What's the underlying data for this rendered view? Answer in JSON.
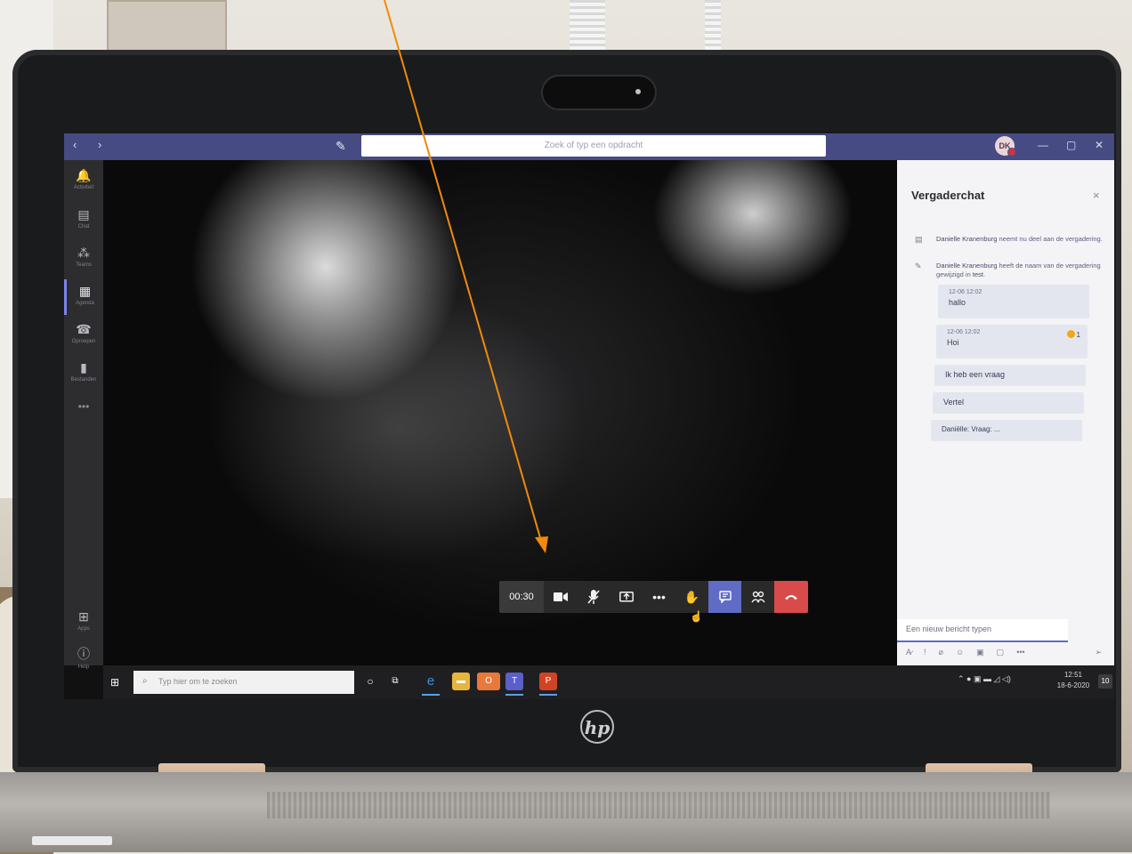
{
  "titlebar": {
    "search_placeholder": "Zoek of typ een opdracht",
    "avatar_initials": "DK",
    "nav_glyphs": "‹ ›",
    "minimize": "—",
    "maximize": "▢",
    "close": "✕"
  },
  "rail": {
    "items": [
      {
        "icon": "bell-icon",
        "glyph": "🔔",
        "label": "Activiteit"
      },
      {
        "icon": "chat-icon",
        "glyph": "▤",
        "label": "Chat"
      },
      {
        "icon": "teams-icon",
        "glyph": "⁂",
        "label": "Teams"
      },
      {
        "icon": "calendar-icon",
        "glyph": "▦",
        "label": "Agenda"
      },
      {
        "icon": "phone-icon",
        "glyph": "☎",
        "label": "Oproepen"
      },
      {
        "icon": "files-icon",
        "glyph": "▮",
        "label": "Bestanden"
      }
    ],
    "more": "•••",
    "apps_label": "Apps",
    "help_label": "Help"
  },
  "controls": {
    "timer": "00:30"
  },
  "chat": {
    "title": "Vergaderchat",
    "close_glyph": "×",
    "system_1": {
      "name": "Danielle Kranenburg",
      "text": " neemt nu deel aan de vergadering."
    },
    "system_2": {
      "name": "Danielle Kranenburg",
      "text_a": " heeft de naam van de vergadering gewijzigd in ",
      "meeting_name": "test",
      "text_b": "."
    },
    "messages": [
      {
        "time": "12-06 12:02",
        "text": "hallo"
      },
      {
        "time": "12-06 12:02",
        "text": "Hoi",
        "reaction_count": "1"
      },
      {
        "time": "",
        "text": "Ik heb een vraag"
      },
      {
        "time": "",
        "text": "Vertel"
      },
      {
        "time": "",
        "text": "Daniëlle: Vraag: ..."
      }
    ],
    "compose_placeholder": "Een nieuw bericht typen"
  },
  "taskbar": {
    "search_placeholder": "Typ hier om te zoeken",
    "clock_time": "12:51",
    "clock_date": "18-6-2020",
    "notification_count": "10"
  },
  "brand": {
    "logo_text": "hp"
  },
  "colors": {
    "teams_purple": "#464b83",
    "active_control": "#5f6bc4",
    "hangup_red": "#d74b4b",
    "annotation_orange": "#f08a0b"
  }
}
